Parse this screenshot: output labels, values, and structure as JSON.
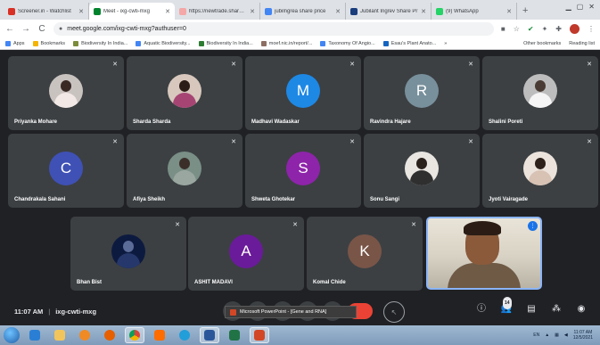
{
  "browser": {
    "tabs": [
      {
        "title": "Screener.in - Watchlist",
        "color": "#d93025"
      },
      {
        "title": "Meet - ixg-cwti-mxg",
        "color": "#00832d",
        "active": true
      },
      {
        "title": "https://newtrade.sharekh",
        "color": "#f5a7a7"
      },
      {
        "title": "jubilngrea share price",
        "color": "#4285f4"
      },
      {
        "title": "Jubilant Ingrev Share Pr",
        "color": "#1a3d7c"
      },
      {
        "title": "(9) WhatsApp",
        "color": "#25d366"
      }
    ],
    "new_tab": "+",
    "url": "meet.google.com/ixg-cwti-mxg?authuser=0",
    "bookmarks": [
      {
        "label": "Apps",
        "color": "#4285f4"
      },
      {
        "label": "Bookmarks",
        "color": "#f4b400"
      },
      {
        "label": "Biodiversity In India...",
        "color": "#7b8c3a"
      },
      {
        "label": "Aquatic Biodiversity...",
        "color": "#4285f4"
      },
      {
        "label": "Biodiversity In India...",
        "color": "#2e7d32"
      },
      {
        "label": "moef.nic.in/report/...",
        "color": "#8d6e63"
      },
      {
        "label": "Taxonomy Of Angio...",
        "color": "#4285f4"
      },
      {
        "label": "Esau's Plant Anato...",
        "color": "#1565c0"
      }
    ],
    "bookmarks_more": "»",
    "other_bookmarks": "Other bookmarks",
    "reading_list": "Reading list"
  },
  "participants": [
    {
      "name": "Priyanka Mohare",
      "kind": "photo",
      "bg": "#c9c3c0",
      "head": "#3a2a25",
      "body": "#f2e9e6"
    },
    {
      "name": "Sharda Sharda",
      "kind": "photo",
      "bg": "#d7c7bd",
      "head": "#2c1c17",
      "body": "#a64573"
    },
    {
      "name": "Madhavi Wadaskar",
      "kind": "letter",
      "letter": "M",
      "bg": "#1e88e5"
    },
    {
      "name": "Ravindra Hajare",
      "kind": "letter",
      "letter": "R",
      "bg": "#78909c"
    },
    {
      "name": "Shalini Poreti",
      "kind": "photo",
      "bg": "#bdbdbd",
      "head": "#4a3c34",
      "body": "#f5f5f5"
    },
    {
      "name": "Chandrakala Sahani",
      "kind": "letter",
      "letter": "C",
      "bg": "#3f51b5"
    },
    {
      "name": "Afiya Sheikh",
      "kind": "photo",
      "bg": "#7a8f86",
      "head": "#3b2f2a",
      "body": "#9aa7a1"
    },
    {
      "name": "Shweta Ghotekar",
      "kind": "letter",
      "letter": "S",
      "bg": "#8e24aa"
    },
    {
      "name": "Sonu Sangi",
      "kind": "photo",
      "bg": "#e9e6e2",
      "head": "#2a211d",
      "body": "#2f2f2f"
    },
    {
      "name": "Jyoti Vairagade",
      "kind": "photo",
      "bg": "#ece4dc",
      "head": "#2e201b",
      "body": "#d7c2b4"
    },
    {
      "name": "Bhan Bist",
      "kind": "photo",
      "bg": "#0d1a40",
      "head": "#5b6c98",
      "body": "#26386b"
    },
    {
      "name": "ASHIT MADAVI",
      "kind": "letter",
      "letter": "A",
      "bg": "#6a1b9a"
    },
    {
      "name": "Komal Chide",
      "kind": "letter",
      "letter": "K",
      "bg": "#795548"
    }
  ],
  "meeting": {
    "time": "11:07 AM",
    "separator": "|",
    "code": "ixg-cwti-mxg",
    "participant_count": "14",
    "popup": "Microsoft PowerPoint - [Gene and RNA]"
  },
  "taskbar": {
    "lang": "EN",
    "time": "11:07 AM",
    "date": "12/5/2021"
  }
}
